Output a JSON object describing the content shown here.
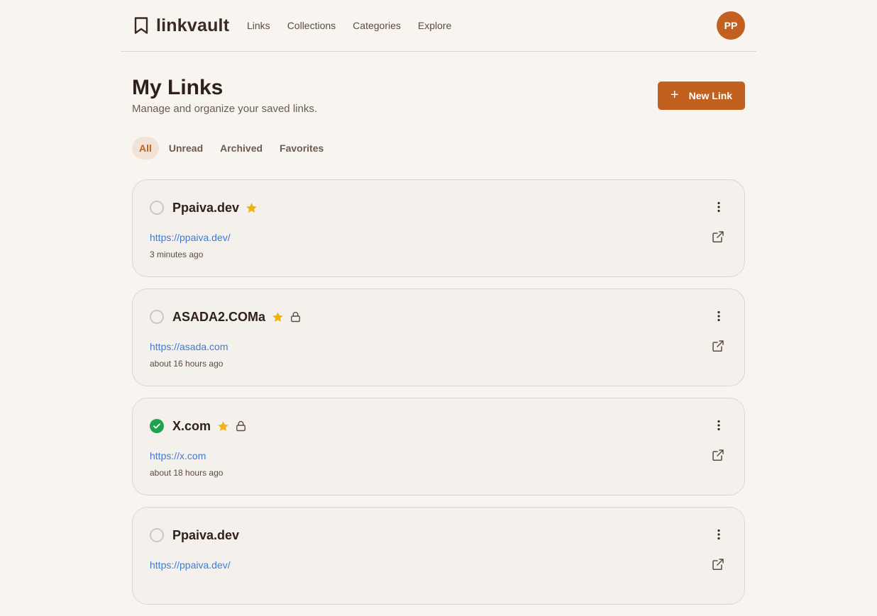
{
  "nav": {
    "brand": "linkvault",
    "brand_icon": "bookmark-icon",
    "links": [
      "Links",
      "Collections",
      "Categories",
      "Explore"
    ],
    "avatar_initials": "PP",
    "accent_color": "#c2611f"
  },
  "header": {
    "title": "My Links",
    "subtitle": "Manage and organize your saved links.",
    "new_link_label": "New Link",
    "new_link_icon": "plus-icon"
  },
  "tabs": [
    {
      "label": "All",
      "active": true
    },
    {
      "label": "Unread",
      "active": false
    },
    {
      "label": "Archived",
      "active": false
    },
    {
      "label": "Favorites",
      "active": false
    }
  ],
  "links": [
    {
      "title": "Ppaiva.dev",
      "url": "https://ppaiva.dev/",
      "time": "3 minutes ago",
      "read": false,
      "favorite": true,
      "private": false
    },
    {
      "title": "ASADA2.COMa",
      "url": "https://asada.com",
      "time": "about 16 hours ago",
      "read": false,
      "favorite": true,
      "private": true
    },
    {
      "title": "X.com",
      "url": "https://x.com",
      "time": "about 18 hours ago",
      "read": true,
      "favorite": true,
      "private": true
    },
    {
      "title": "Ppaiva.dev",
      "url": "https://ppaiva.dev/",
      "time": "",
      "read": false,
      "favorite": false,
      "private": false
    }
  ],
  "colors": {
    "star": "#f2b20c",
    "read_check": "#1fa24e",
    "url": "#3f7ad6"
  }
}
